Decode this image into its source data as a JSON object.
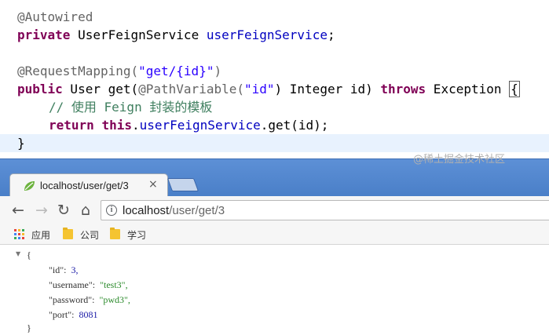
{
  "editor": {
    "line1": {
      "annotation": "@Autowired"
    },
    "line2": {
      "keyword": "private",
      "type": " UserFeignService ",
      "field": "userFeignService",
      "end": ";"
    },
    "line4": {
      "annotation": "@RequestMapping(",
      "path": "\"get/{id}\"",
      "end": ")"
    },
    "line5": {
      "keyword": "public",
      "sig_a": " User get(",
      "annotation": "@PathVariable(",
      "arg": "\"id\"",
      "sig_b": ") Integer id) ",
      "throws": "throws",
      "sig_c": " Exception ",
      "brace": "{"
    },
    "line6": {
      "comment": "// 使用 Feign 封装的模板"
    },
    "line7": {
      "return_kw": "return",
      "this_kw": "this",
      "dot": ".",
      "field": "userFeignService",
      "call": ".get(id);"
    },
    "line8": {
      "brace": "}"
    }
  },
  "browser": {
    "tab_title": "localhost/user/get/3",
    "tab_close": "×",
    "url_host": "localhost",
    "url_path": "/user/get/3",
    "info_glyph": "i",
    "nav": {
      "back": "←",
      "forward": "→",
      "reload": "↻",
      "home": "⌂"
    },
    "bookmarks": [
      {
        "label": "应用",
        "icon": "apps-icon"
      },
      {
        "label": "公司",
        "icon": "folder-icon"
      },
      {
        "label": "学习",
        "icon": "folder-icon"
      }
    ],
    "json": {
      "collapse": "▼",
      "open": "{",
      "close": "}",
      "id_key": "\"id\":",
      "id_val": "3,",
      "username_key": "\"username\":",
      "username_val": "\"test3\",",
      "password_key": "\"password\":",
      "password_val": "\"pwd3\",",
      "port_key": "\"port\":",
      "port_val": "8081"
    }
  },
  "watermark": "@稀土掘金技术社区",
  "colors": {
    "keyword": "#7f0055",
    "string": "#2a00ff",
    "field": "#0000c0",
    "comment": "#3f7f5f",
    "annotation": "#646464",
    "frame": "#4a7fc8"
  }
}
